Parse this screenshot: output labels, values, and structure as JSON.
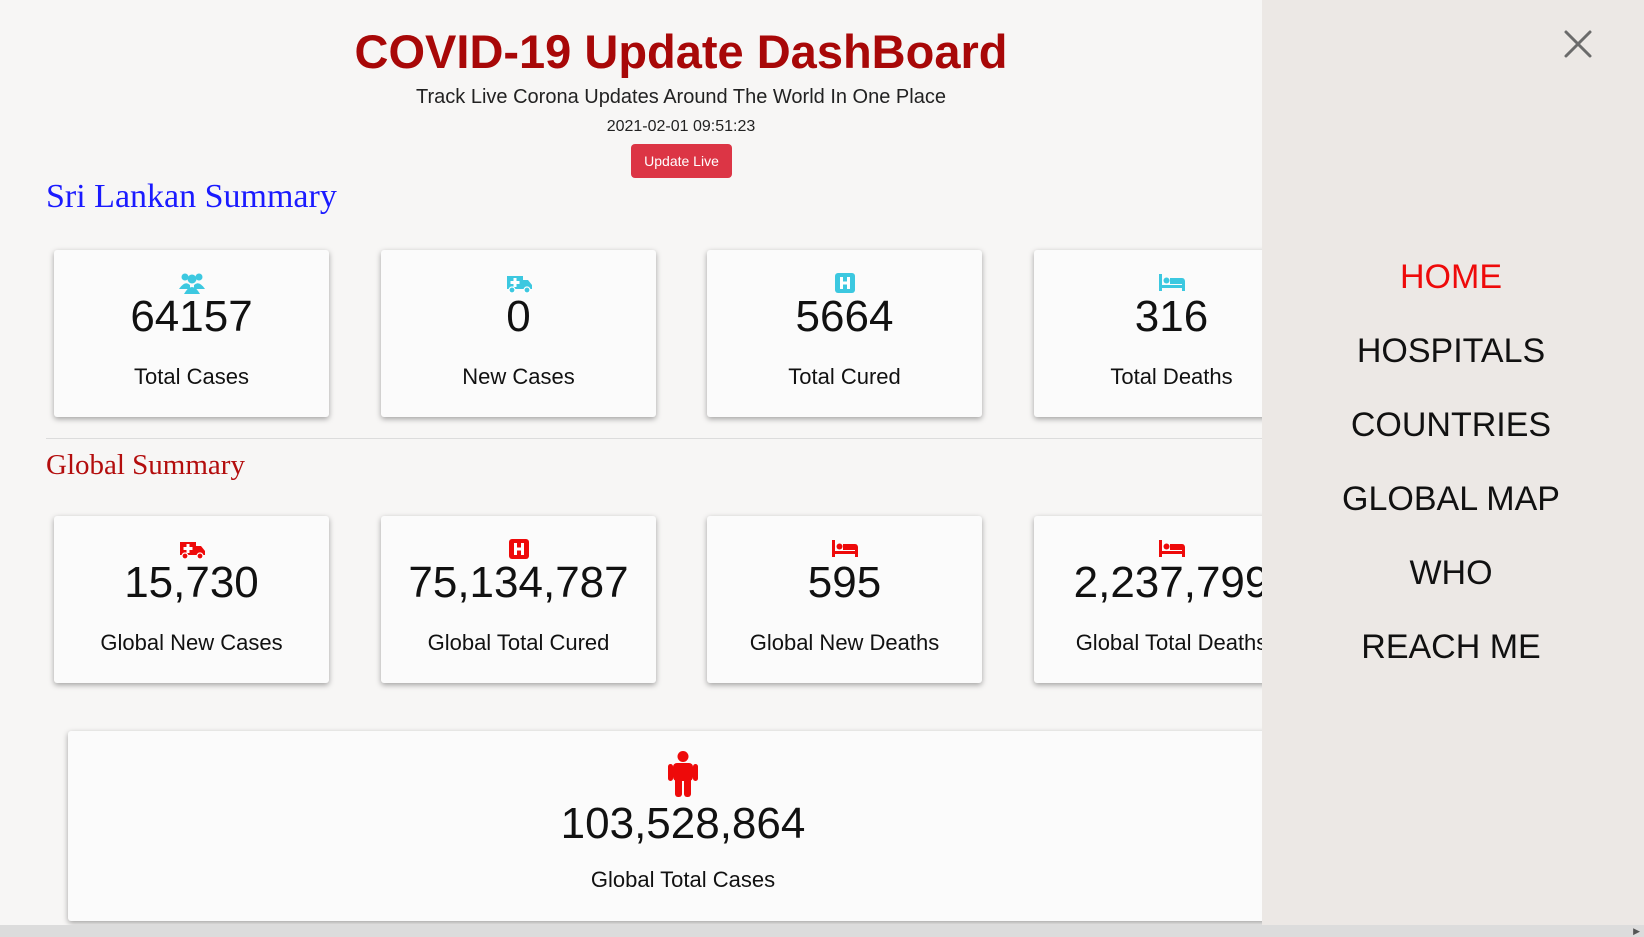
{
  "header": {
    "title": "COVID-19 Update DashBoard",
    "subtitle": "Track Live Corona Updates Around The World In One Place",
    "timestamp": "2021-02-01 09:51:23",
    "update_button": "Update Live"
  },
  "sri_lanka": {
    "title": "Sri Lankan Summary",
    "icon_color": "#3cc8e0",
    "cards": [
      {
        "icon": "users-icon",
        "value": "64157",
        "label": "Total Cases"
      },
      {
        "icon": "ambulance-icon",
        "value": "0",
        "label": "New Cases"
      },
      {
        "icon": "hospital-icon",
        "value": "5664",
        "label": "Total Cured"
      },
      {
        "icon": "bed-icon",
        "value": "316",
        "label": "Total Deaths"
      }
    ]
  },
  "global": {
    "title": "Global Summary",
    "icon_color": "#ee0a0a",
    "cards": [
      {
        "icon": "ambulance-icon",
        "value": "15,730",
        "label": "Global New Cases"
      },
      {
        "icon": "hospital-icon",
        "value": "75,134,787",
        "label": "Global Total Cured"
      },
      {
        "icon": "bed-icon",
        "value": "595",
        "label": "Global New Deaths"
      },
      {
        "icon": "bed-icon",
        "value": "2,237,799",
        "label": "Global Total Deaths"
      }
    ],
    "total_card": {
      "icon": "person-icon",
      "value": "103,528,864",
      "label": "Global Total Cases"
    }
  },
  "sidebar": {
    "close_icon": "close-icon",
    "items": [
      {
        "label": "HOME",
        "active": true
      },
      {
        "label": "HOSPITALS",
        "active": false
      },
      {
        "label": "COUNTRIES",
        "active": false
      },
      {
        "label": "GLOBAL MAP",
        "active": false
      },
      {
        "label": "WHO",
        "active": false
      },
      {
        "label": "REACH ME",
        "active": false
      }
    ]
  }
}
